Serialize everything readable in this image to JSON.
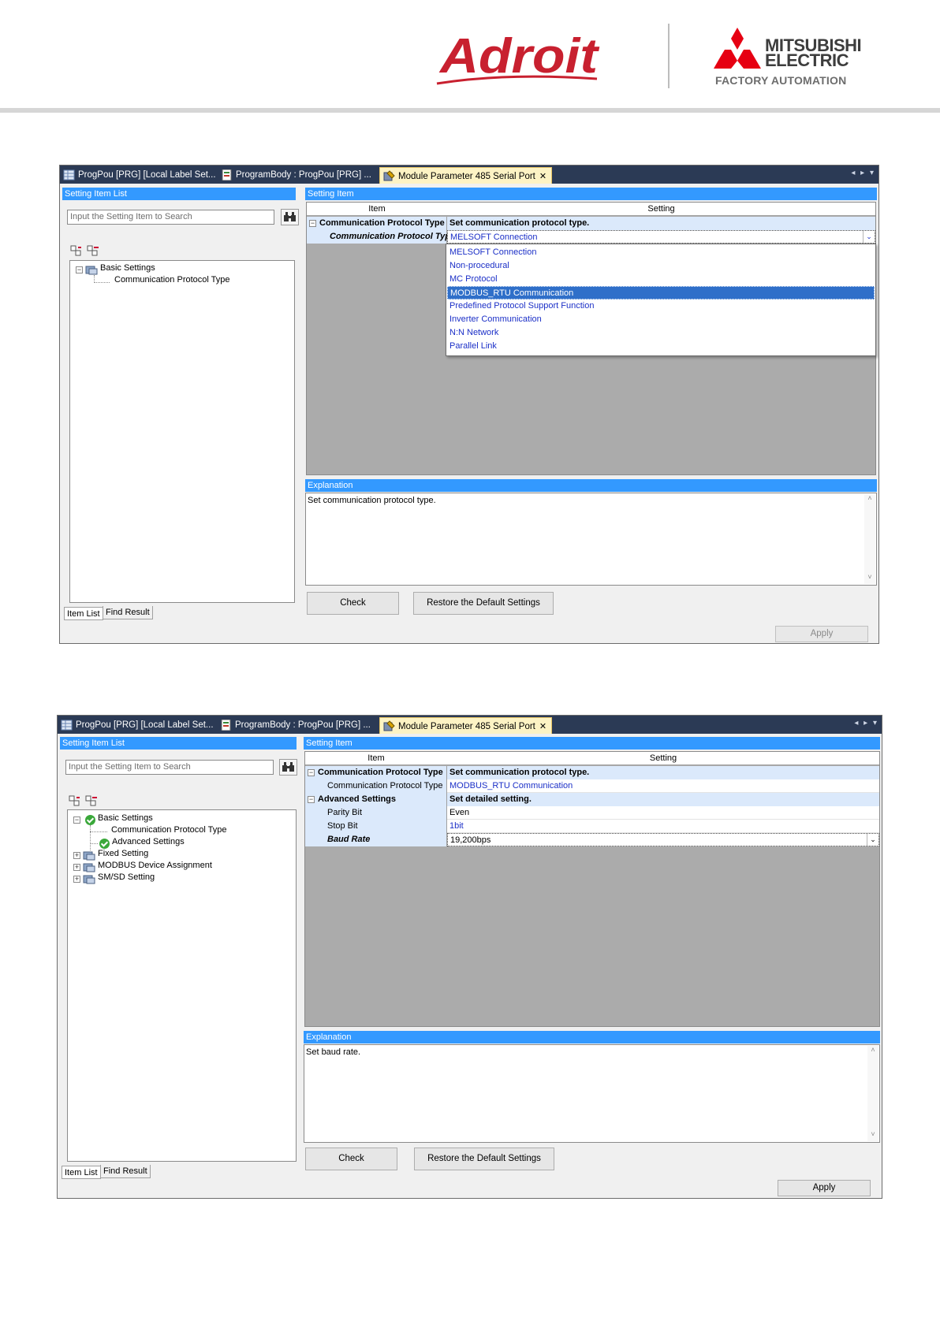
{
  "brand": {
    "adroit": "Adroit",
    "mitsubishi_line1": "MITSUBISHI",
    "mitsubishi_line2": "ELECTRIC",
    "mitsubishi_sub": "FACTORY AUTOMATION",
    "colors": {
      "adroit_red": "#c8202f",
      "mitsubishi_red": "#e60012",
      "panel_blue": "#3399ff",
      "tab_bar": "#2b3a55"
    }
  },
  "screen1": {
    "tabs": [
      {
        "label": "ProgPou [PRG] [Local Label Set...",
        "icon": "label-table-icon"
      },
      {
        "label": "ProgramBody : ProgPou [PRG] ...",
        "icon": "program-body-icon"
      },
      {
        "label": "Module Parameter 485 Serial Port",
        "icon": "module-parameter-icon",
        "active": true
      }
    ],
    "left_panel_title": "Setting Item List",
    "search_placeholder": "Input the Setting Item to Search",
    "tree": [
      {
        "label": "Basic Settings"
      },
      {
        "label": "Communication Protocol Type"
      }
    ],
    "bottom_tabs": [
      "Item List",
      "Find Result"
    ],
    "right_panel_title": "Setting Item",
    "col_item": "Item",
    "col_setting": "Setting",
    "rows": [
      {
        "item": "Communication Protocol Type",
        "setting": "Set communication protocol type."
      },
      {
        "item": "Communication Protocol Type",
        "setting": "MELSOFT Connection"
      }
    ],
    "dropdown_options": [
      "MELSOFT Connection",
      "Non-procedural",
      "MC Protocol",
      "MODBUS_RTU Communication",
      "Predefined Protocol Support Function",
      "Inverter Communication",
      "N:N Network",
      "Parallel Link"
    ],
    "dropdown_selected": "MODBUS_RTU Communication",
    "explanation_title": "Explanation",
    "explanation_text": "Set communication protocol type.",
    "btn_check": "Check",
    "btn_restore": "Restore the Default Settings",
    "btn_apply": "Apply"
  },
  "screen2": {
    "tabs": [
      {
        "label": "ProgPou [PRG] [Local Label Set...",
        "icon": "label-table-icon"
      },
      {
        "label": "ProgramBody : ProgPou [PRG] ...",
        "icon": "program-body-icon"
      },
      {
        "label": "Module Parameter 485 Serial Port",
        "icon": "module-parameter-icon",
        "active": true
      }
    ],
    "left_panel_title": "Setting Item List",
    "search_placeholder": "Input the Setting Item to Search",
    "tree": [
      {
        "label": "Basic Settings"
      },
      {
        "label": "Communication Protocol Type"
      },
      {
        "label": "Advanced Settings"
      },
      {
        "label": "Fixed Setting"
      },
      {
        "label": "MODBUS Device Assignment"
      },
      {
        "label": "SM/SD Setting"
      }
    ],
    "bottom_tabs": [
      "Item List",
      "Find Result"
    ],
    "right_panel_title": "Setting Item",
    "col_item": "Item",
    "col_setting": "Setting",
    "rows": [
      {
        "item": "Communication Protocol Type",
        "setting": "Set communication protocol type."
      },
      {
        "item": "Communication Protocol Type",
        "setting": "MODBUS_RTU Communication"
      },
      {
        "item": "Advanced Settings",
        "setting": "Set detailed setting."
      },
      {
        "item": "Parity Bit",
        "setting": "Even"
      },
      {
        "item": "Stop Bit",
        "setting": "1bit"
      },
      {
        "item": "Baud Rate",
        "setting": "19,200bps"
      }
    ],
    "explanation_title": "Explanation",
    "explanation_text": "Set baud rate.",
    "btn_check": "Check",
    "btn_restore": "Restore the Default Settings",
    "btn_apply": "Apply"
  }
}
